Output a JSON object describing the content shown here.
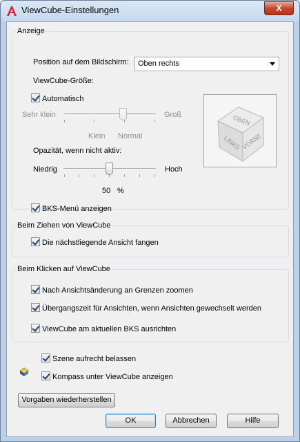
{
  "window": {
    "title": "ViewCube-Einstellungen",
    "close_label": "X"
  },
  "anzeige": {
    "group_title": "Anzeige",
    "position_label": "Position auf dem Bildschirm:",
    "position_value": "Oben rechts",
    "size_label": "ViewCube-Größe:",
    "automatic_label": "Automatisch",
    "size_slider": {
      "min_label": "Sehr klein",
      "max_label": "Groß",
      "mark_small": "Klein",
      "mark_normal": "Normal",
      "value": "Normal"
    },
    "opacity_label": "Opazität, wenn nicht aktiv:",
    "opacity_slider": {
      "min_label": "Niedrig",
      "max_label": "Hoch",
      "value_percent": 50
    },
    "opacity_value": "50",
    "opacity_unit": "%",
    "ucs_menu_label": "BKS-Menü anzeigen",
    "cube_faces": {
      "top": "OBEN",
      "left": "LINKS",
      "right": "VORNE"
    }
  },
  "drag": {
    "group_title": "Beim Ziehen von ViewCube",
    "snap_label": "Die nächstliegende Ansicht fangen"
  },
  "click": {
    "group_title": "Beim Klicken auf ViewCube",
    "zoom_label": "Nach Ansichtsänderung an Grenzen zoomen",
    "transition_label": "Übergangszeit für Ansichten, wenn Ansichten gewechselt werden",
    "orient_label": "ViewCube am aktuellen BKS ausrichten"
  },
  "scene_upright_label": "Szene aufrecht belassen",
  "compass_label": "Kompass unter ViewCube anzeigen",
  "buttons": {
    "restore": "Vorgaben wiederherstellen",
    "ok": "OK",
    "cancel": "Abbrechen",
    "help": "Hilfe"
  },
  "colors": {
    "titlebar": "#c4d8ef",
    "client": "#f0f0f0",
    "close": "#c7452e",
    "icon_red": "#d22b2b"
  },
  "icons": [
    "autocad-a-icon",
    "close-icon",
    "chevron-down-icon",
    "compass-icon",
    "checkbox-icon"
  ]
}
